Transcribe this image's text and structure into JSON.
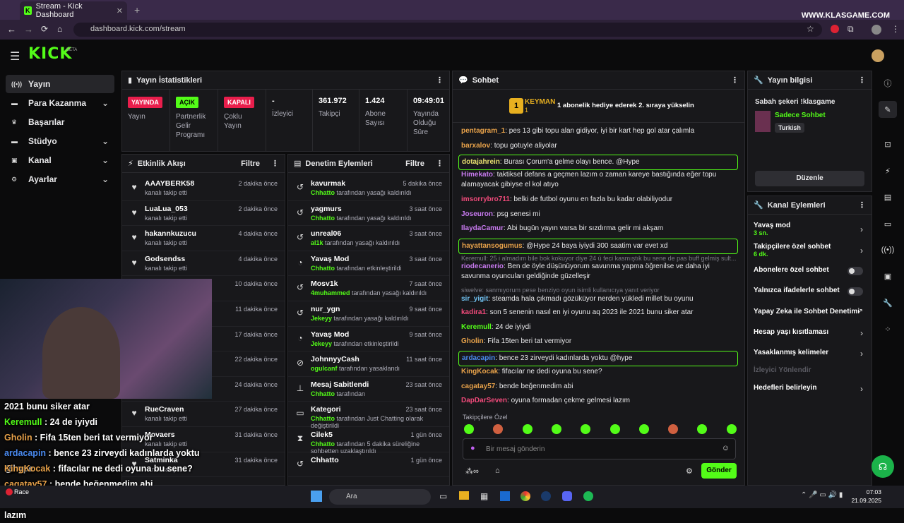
{
  "browser": {
    "tab_title": "Stream - Kick Dashboard",
    "url": "dashboard.kick.com/stream",
    "watermark": "WWW.KLASGAME.COM"
  },
  "header": {
    "logo": "KICK",
    "beta": "BETA"
  },
  "sidebar": {
    "items": [
      {
        "label": "Yayın",
        "icon": "broadcast-icon",
        "active": true
      },
      {
        "label": "Para Kazanma",
        "icon": "money-icon",
        "expand": true
      },
      {
        "label": "Başarılar",
        "icon": "trophy-icon"
      },
      {
        "label": "Stüdyo",
        "icon": "studio-icon",
        "expand": true
      },
      {
        "label": "Kanal",
        "icon": "channel-icon",
        "expand": true
      },
      {
        "label": "Ayarlar",
        "icon": "gear-icon",
        "expand": true
      }
    ]
  },
  "stats": {
    "title": "Yayın İstatistikleri",
    "cells": [
      {
        "badge": "YAYINDA",
        "badge_color": "#e91e4c",
        "label": "Yayın"
      },
      {
        "badge": "AÇIK",
        "badge_color": "#53fc18",
        "label": "Partnerlik Gelir Programı"
      },
      {
        "badge": "KAPALI",
        "badge_color": "#e91e4c",
        "label": "Çoklu Yayın"
      },
      {
        "value": "-",
        "label": "İzleyici"
      },
      {
        "value": "361.972",
        "label": "Takipçi"
      },
      {
        "value": "1.424",
        "label": "Abone Sayısı"
      },
      {
        "value": "09:49:01",
        "label": "Yayında Olduğu Süre"
      }
    ]
  },
  "activity": {
    "title": "Etkinlik Akışı",
    "filter": "Filtre",
    "rows": [
      {
        "name": "AAAYBERK58",
        "sub": "kanalı takip etti",
        "time": "2 dakika önce"
      },
      {
        "name": "LuaLua_053",
        "sub": "kanalı takip etti",
        "time": "2 dakika önce"
      },
      {
        "name": "hakannkuzucu",
        "sub": "kanalı takip etti",
        "time": "4 dakika önce"
      },
      {
        "name": "Godsendss",
        "sub": "kanalı takip etti",
        "time": "4 dakika önce"
      },
      {
        "name": "",
        "sub": "",
        "time": "10 dakika önce"
      },
      {
        "name": "",
        "sub": "",
        "time": "11 dakika önce"
      },
      {
        "name": "",
        "sub": "",
        "time": "17 dakika önce"
      },
      {
        "name": "",
        "sub": "",
        "time": "22 dakika önce"
      },
      {
        "name": "",
        "sub": "",
        "time": "24 dakika önce"
      },
      {
        "name": "RueCraven",
        "sub": "kanalı takip etti",
        "time": "27 dakika önce"
      },
      {
        "name": "Movaers",
        "sub": "kanalı takip etti",
        "time": "31 dakika önce"
      },
      {
        "name": "Satminka",
        "sub": "kanalı takip etti",
        "time": "31 dakika önce"
      }
    ]
  },
  "moderation": {
    "title": "Denetim Eylemleri",
    "filter": "Filtre",
    "rows": [
      {
        "name": "kavurmak",
        "by": "Chhatto",
        "rest": " tarafından yasağı kaldırıldı",
        "time": "5 dakika önce"
      },
      {
        "name": "yagmurs",
        "by": "Chhatto",
        "rest": " tarafından yasağı kaldırıldı",
        "time": "3 saat önce"
      },
      {
        "name": "unreal06",
        "by": "al1k",
        "rest": " tarafından yasağı kaldırıldı",
        "time": "3 saat önce"
      },
      {
        "name": "Yavaş Mod",
        "by": "Chhatto",
        "rest": " tarafından etkinleştirildi",
        "time": "3 saat önce"
      },
      {
        "name": "Mosv1k",
        "by": "4muhammed",
        "rest": " tarafından yasağı kaldırıldı",
        "time": "7 saat önce"
      },
      {
        "name": "nur_ygn",
        "by": "Jekeyy",
        "rest": " tarafından yasağı kaldırıldı",
        "time": "9 saat önce"
      },
      {
        "name": "Yavaş Mod",
        "by": "Jekeyy",
        "rest": " tarafından etkinleştirildi",
        "time": "9 saat önce"
      },
      {
        "name": "JohnnyyCash",
        "by": "ogulcanf",
        "rest": " tarafından yasaklandı",
        "time": "11 saat önce"
      },
      {
        "name": "Mesaj Sabitlendi",
        "by": "Chhatto",
        "rest": " tarafından",
        "time": "23 saat önce"
      },
      {
        "name": "Kategori",
        "by": "Chhatto",
        "rest": " tarafından Just Chatting olarak değiştirildi",
        "time": "23 saat önce"
      },
      {
        "name": "Cilek5",
        "by": "Chhatto",
        "rest": " tarafından 5 dakika süreliğine sohbetten uzaklaştırıldı",
        "time": "1 gün önce"
      },
      {
        "name": "Chhatto",
        "by": "",
        "rest": "",
        "time": "1 gün önce"
      }
    ]
  },
  "chat": {
    "title": "Sohbet",
    "gift_user": "KEYMAN",
    "gift_rank": "1",
    "gift_count": "1",
    "gift_text": "1 abonelik hediye ederek 2. sıraya yükselin",
    "lines": [
      {
        "u": "pentagram_1",
        "c": "#e8a24a",
        "t": ": pes 13 gibi topu alan gidiyor, iyi bir kart hep gol atar çalımla"
      },
      {
        "u": "barxalov",
        "c": "#e8a24a",
        "t": ": topu gotuyle aliyolar"
      },
      {
        "u": "dotajahrein",
        "c": "#e8e070",
        "t": ": Burası Çorum'a gelme olayı bence. @Hype",
        "hl": true
      },
      {
        "u": "Himekato",
        "c": "#c87af0",
        "t": ": taktiksel defans a geçmen lazım o zaman kareye bastığında eğer topu alamayacak gibiyse el kol atıyo"
      },
      {
        "u": "imsorrybro711",
        "c": "#f04a7a",
        "t": ": belki de futbol oyunu en fazla bu kadar olabiliyodur"
      },
      {
        "u": "Joseuron",
        "c": "#c87af0",
        "t": ": psg senesi mi"
      },
      {
        "u": "IlaydaCamur",
        "c": "#c87af0",
        "t": ": Abi bugün yayın varsa bir sızdırma gelir mi akşam"
      },
      {
        "u": "hayattansogumus",
        "c": "#e8a24a",
        "t": ": @Hype 24 baya iyiydi 300 saatim var evet xd",
        "hl": true
      },
      {
        "u": "",
        "c": "#7b7b85",
        "t": "Keremull: 25 i almadım bile bok kokuyor diye 24 ü feci kasmıştık bu sene de pas buff gelmiş sult...",
        "muted": true
      },
      {
        "u": "riodecanerio",
        "c": "#c87af0",
        "t": ": Ben de öyle düşünüyorum savunma yapma öğrenilse ve daha iyi savunma oyuncuları geldiğinde güzelleşir"
      },
      {
        "u": "",
        "c": "#7b7b85",
        "t": "siwelve: sanmıyorum pese benziyo oyun isimli kullanıcıya yanıt veriyor",
        "muted": true
      },
      {
        "u": "sir_yigit",
        "c": "#70c0f0",
        "t": ": steamda hala çıkmadı gözüküyor nerden yükledi millet bu oyunu"
      },
      {
        "u": "kadira1",
        "c": "#f04a7a",
        "t": ": son 5 senenin nasıl en iyi oyunu aq 2023 ile 2021 bunu siker atar"
      },
      {
        "u": "Keremull",
        "c": "#53fc18",
        "t": ": 24 de iyiydi"
      },
      {
        "u": "Gholin",
        "c": "#e8a24a",
        "t": ": Fifa 15ten beri tat vermiyor"
      },
      {
        "u": "ardacapin",
        "c": "#4a8af0",
        "t": ": bence 23 zirveydi kadınlarda yoktu @hype",
        "hl": true
      },
      {
        "u": "KingKocak",
        "c": "#e8a24a",
        "t": ": fifacılar ne dedi oyuna bu sene?"
      },
      {
        "u": "cagatay57",
        "c": "#e8a24a",
        "t": ": bende beğenmedim abi"
      },
      {
        "u": "DapDarSeven",
        "c": "#f04a7a",
        "t": ": oyuna formadan çekme gelmesi lazım"
      }
    ],
    "mode": "Takipçilere Özel",
    "input_placeholder": "Bir mesaj gönderin",
    "send": "Gönder"
  },
  "info": {
    "title": "Yayın bilgisi",
    "stream_title": "Sabah şekeri !klasgame",
    "category": "Sadece Sohbet",
    "tag": "Turkish",
    "edit": "Düzenle"
  },
  "actions": {
    "title": "Kanal Eylemleri",
    "items": [
      {
        "label": "Yavaş mod",
        "sub": "3 sn.",
        "type": "arrow"
      },
      {
        "label": "Takipçilere özel sohbet",
        "sub": "6 dk.",
        "type": "arrow"
      },
      {
        "label": "Abonelere özel sohbet",
        "type": "toggle"
      },
      {
        "label": "Yalnızca ifadelerle sohbet",
        "type": "toggle"
      },
      {
        "label": "Yapay Zeka ile Sohbet Denetimi",
        "type": "ext"
      },
      {
        "label": "Hesap yaşı kısıtlaması",
        "type": "arrow"
      },
      {
        "label": "Yasaklanmış kelimeler",
        "type": "arrow"
      },
      {
        "label": "İzleyici Yönlendir",
        "type": "disabled"
      },
      {
        "label": "Hedefleri belirleyin",
        "type": "arrow"
      }
    ]
  },
  "overlay": {
    "lines": [
      {
        "u": "",
        "c": "#fff",
        "t": "2021 bunu siker atar"
      },
      {
        "u": "Keremull",
        "c": "#53fc18",
        "t": " : 24 de iyiydi"
      },
      {
        "u": "Gholin",
        "c": "#e8a24a",
        "t": " : Fifa 15ten beri tat vermiyor"
      },
      {
        "u": "ardacapin",
        "c": "#4a8af0",
        "t": " : bence 23 zirveydi kadınlarda yoktu @hype"
      },
      {
        "u": "KingKocak",
        "c": "#e8a24a",
        "t": " : fifacılar ne dedi oyuna bu sene?"
      },
      {
        "u": "cagatay57",
        "c": "#e8a24a",
        "t": " : bende beğenmedim abi"
      },
      {
        "u": "DapDarSeven",
        "c": "#f04a7a",
        "t": " : oyuna formadan çekme gelmesi lazım"
      }
    ]
  },
  "taskbar": {
    "search": "Ara",
    "time": "07:03",
    "date": "21.09.2025",
    "notif": "Race"
  }
}
